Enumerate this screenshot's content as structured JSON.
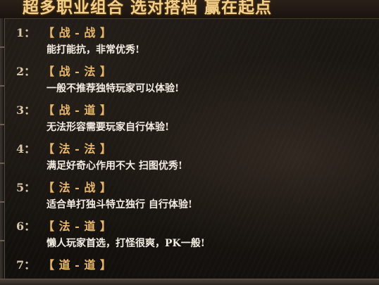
{
  "banner": {
    "title": "超多职业组合 选对搭档 赢在起点"
  },
  "items": [
    {
      "num": "1：",
      "combo": "【 战 - 战 】",
      "desc": "能打能抗，非常优秀!"
    },
    {
      "num": "2：",
      "combo": "【 战 - 法 】",
      "desc": "一般不推荐独特玩家可以体验!"
    },
    {
      "num": "3：",
      "combo": "【 战 - 道 】",
      "desc": "无法形容需要玩家自行体验!"
    },
    {
      "num": "4：",
      "combo": "【 法 - 法 】",
      "desc": "满足好奇心作用不大  扫图优秀!"
    },
    {
      "num": "5：",
      "combo": "【 法 - 战 】",
      "desc": "适合单打独斗特立独行 自行体验!"
    },
    {
      "num": "6：",
      "combo": "【 法 - 道 】",
      "desc": "懒人玩家首选，打怪很爽，PK一般!"
    },
    {
      "num": "7：",
      "combo": "【 道 - 道 】",
      "desc": ""
    }
  ]
}
